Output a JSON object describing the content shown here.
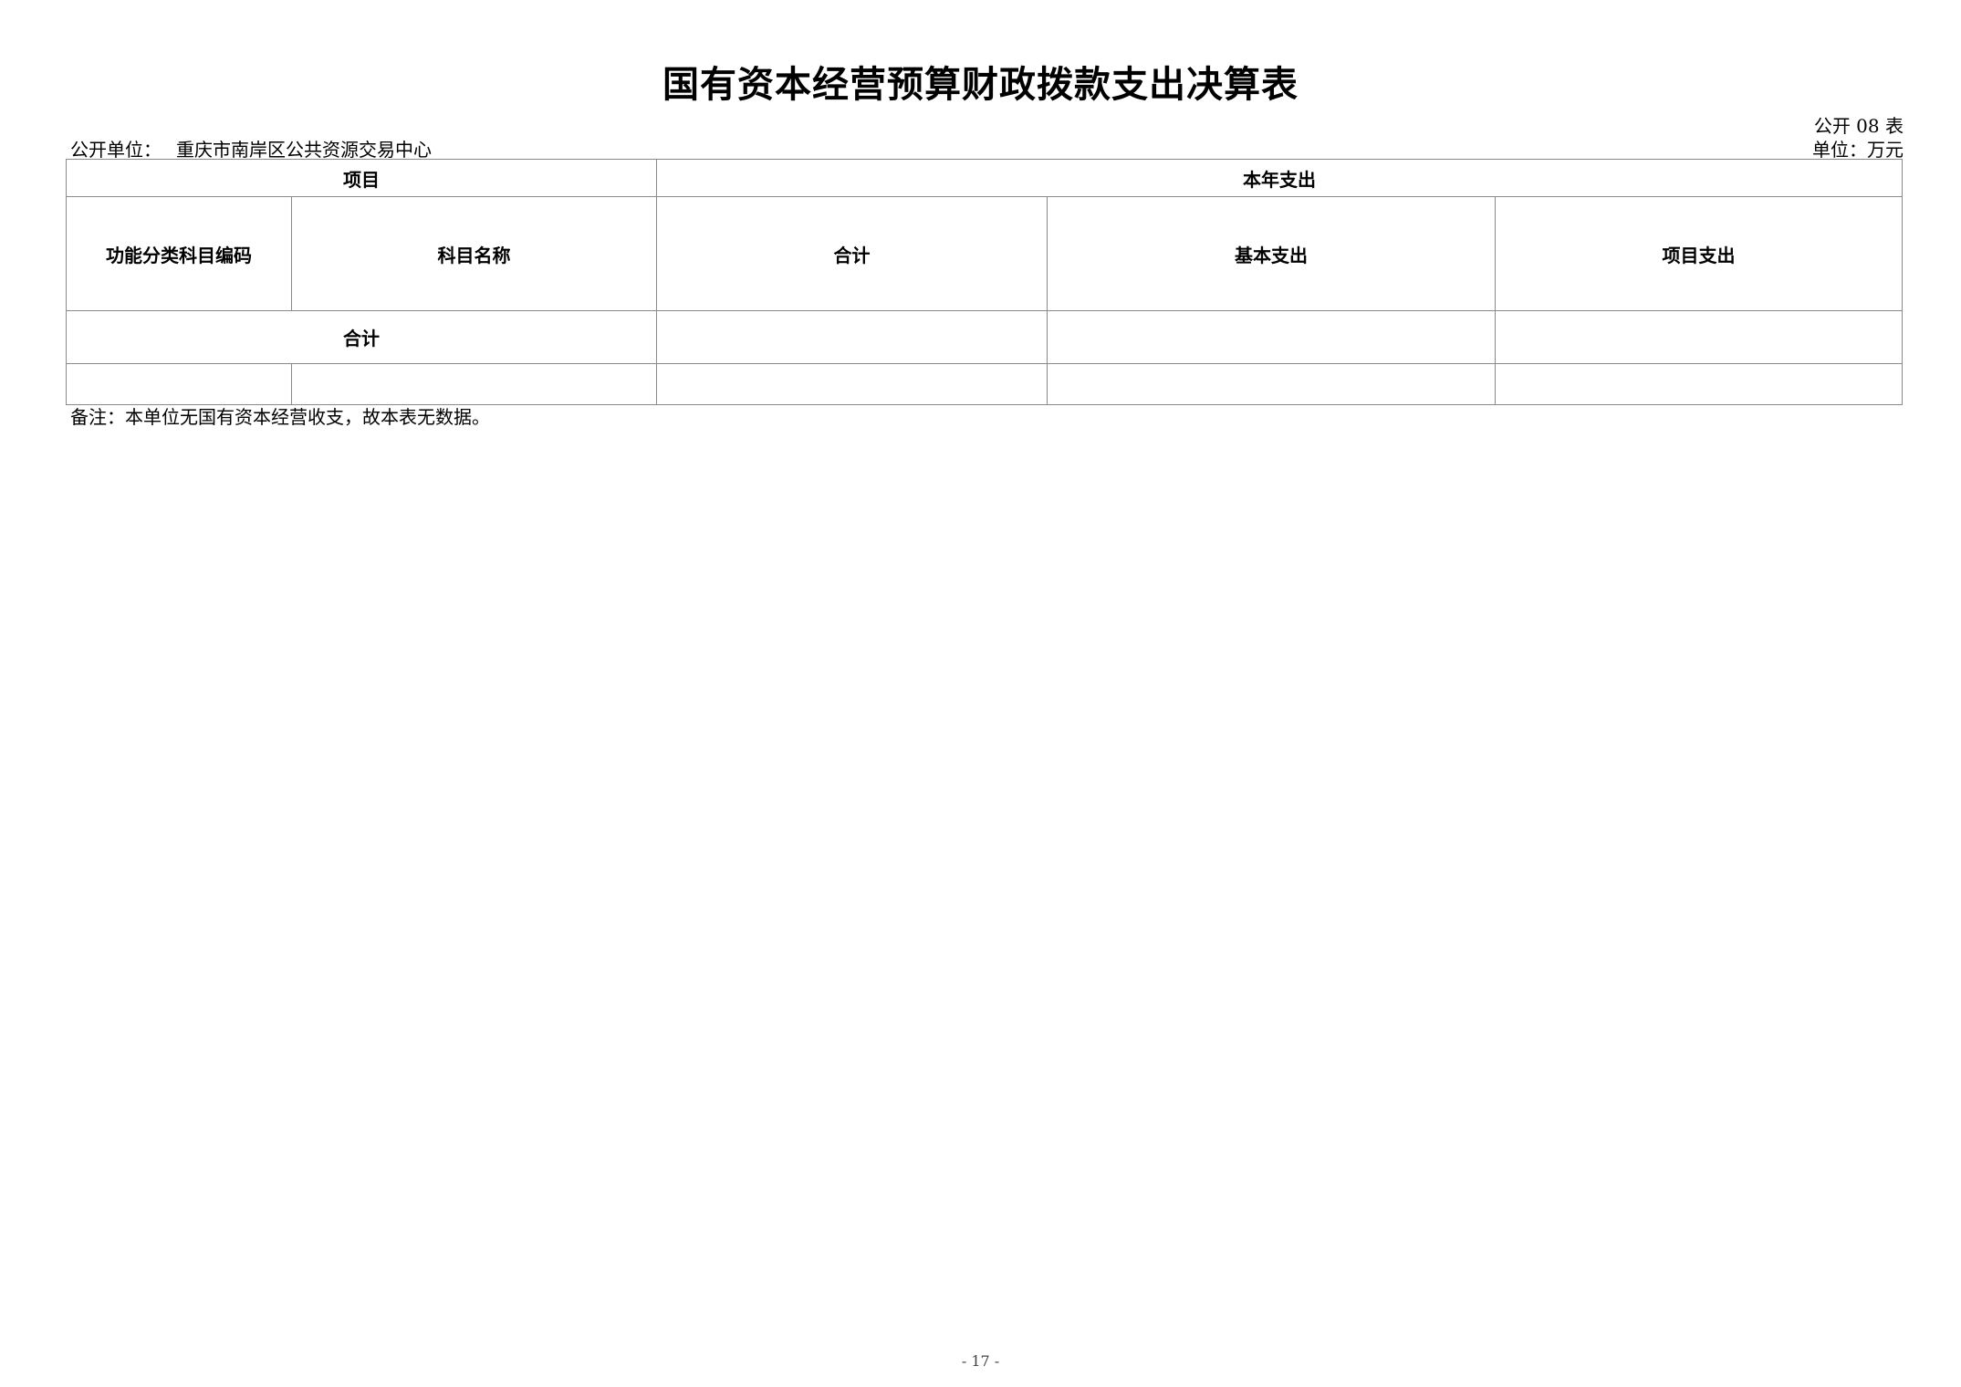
{
  "document": {
    "title": "国有资本经营预算财政拨款支出决算表",
    "form_code": "公开 08 表",
    "unit_label": "公开单位：",
    "unit_name": "重庆市南岸区公共资源交易中心",
    "currency_unit": "单位：万元"
  },
  "table": {
    "header_project": "项目",
    "header_current_year": "本年支出",
    "col_code": "功能分类科目编码",
    "col_name": "科目名称",
    "col_total": "合计",
    "col_basic": "基本支出",
    "col_project": "项目支出",
    "total_row_label": "合计"
  },
  "remark": "备注：本单位无国有资本经营收支，故本表无数据。",
  "page_number": "- 17 -"
}
